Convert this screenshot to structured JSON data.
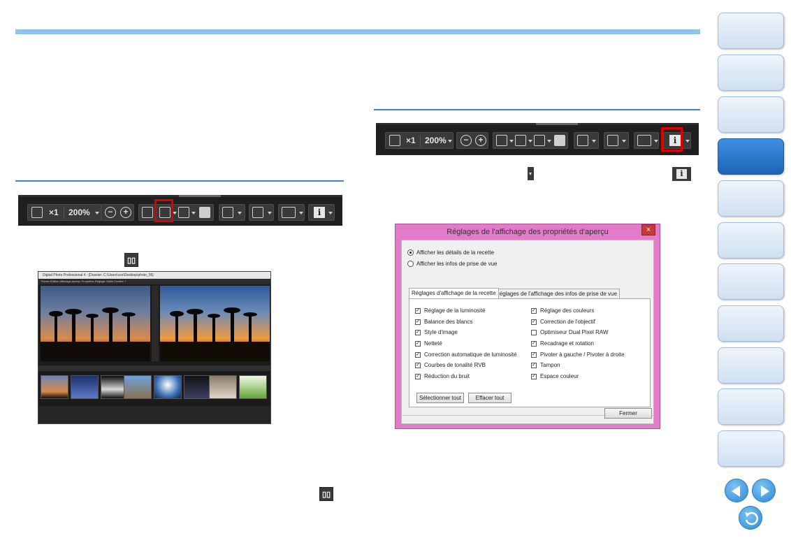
{
  "toolbar": {
    "zoom_x1": "×1",
    "zoom_level": "200%"
  },
  "dialog": {
    "title": "Réglages de l'affichage des propriétés d'aperçu",
    "close": "×",
    "radios": [
      {
        "label": "Afficher les détails de la recette",
        "checked": true
      },
      {
        "label": "Afficher les infos de prise de vue",
        "checked": false
      }
    ],
    "tabs": [
      {
        "label": "Réglages d'affichage de la recette",
        "active": true
      },
      {
        "label": "Réglages de l'affichage des infos de prise de vue",
        "active": false
      }
    ],
    "checkboxes_left": [
      {
        "label": "Réglage de la luminosité",
        "checked": true
      },
      {
        "label": "Balance des blancs",
        "checked": true
      },
      {
        "label": "Style d'image",
        "checked": true
      },
      {
        "label": "Netteté",
        "checked": true
      },
      {
        "label": "Correction automatique de luminosité",
        "checked": true
      },
      {
        "label": "Courbes de tonalité RVB",
        "checked": true
      },
      {
        "label": "Réduction du bruit",
        "checked": true
      }
    ],
    "checkboxes_right": [
      {
        "label": "Réglage des couleurs",
        "checked": true
      },
      {
        "label": "Correction de l'objectif",
        "checked": true
      },
      {
        "label": "Optimiseur Dual Pixel RAW",
        "checked": false
      },
      {
        "label": "Recadrage et rotation",
        "checked": true
      },
      {
        "label": "Pivoter à gauche / Pivoter à droite",
        "checked": true
      },
      {
        "label": "Tampon",
        "checked": true
      },
      {
        "label": "Espace couleur",
        "checked": true
      }
    ],
    "select_all": "Sélectionner tout",
    "clear_all": "Effacer tout",
    "close_button": "Fermer"
  },
  "app_screenshot": {
    "title": "Digital Photo Professional 4 - [Dossier: C:\\Users\\xxx\\Desktop\\photo_05]",
    "menu": "Fichier   Édition   Affichage   Aperçu   Propriétés   Réglage   Outils   Fenêtre   ?"
  },
  "colors": {
    "accent": "#3b86d4",
    "topbar": "#8fc4ea",
    "dialog_frame": "#e27cc9",
    "highlight": "#e00000",
    "nav_active": "#1d63b5"
  }
}
